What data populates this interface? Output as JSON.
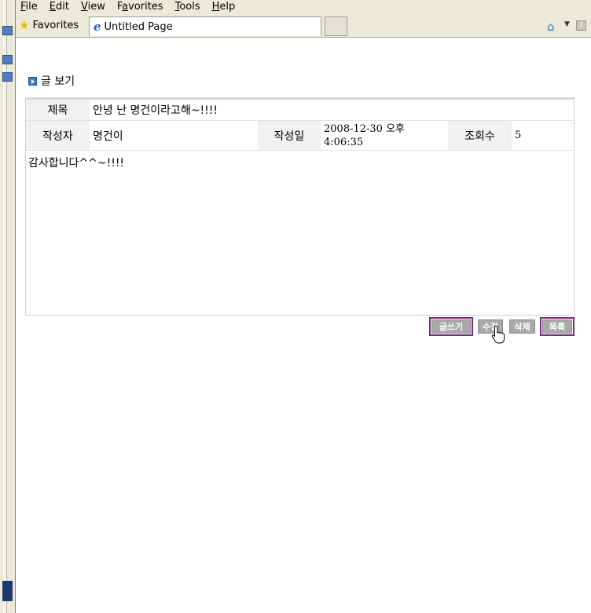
{
  "menu": {
    "items": [
      {
        "key": "F",
        "rest": "ile"
      },
      {
        "key": "E",
        "rest": "dit"
      },
      {
        "key": "V",
        "rest": "iew"
      },
      {
        "key": "a",
        "pre": "F",
        "rest": "vorites"
      },
      {
        "key": "T",
        "rest": "ools"
      },
      {
        "key": "H",
        "rest": "elp"
      }
    ]
  },
  "toolbar": {
    "favorites_label": "Favorites",
    "tab_title": "Untitled Page",
    "icons": [
      "star-icon",
      "ie-icon",
      "home-icon",
      "rss-icon"
    ]
  },
  "page": {
    "section_title": "글 보기",
    "post": {
      "title_label": "제목",
      "title_value": "안녕 난 명건이라고해~!!!!",
      "author_label": "작성자",
      "author_value": "명건이",
      "date_label": "작성일",
      "date_value_line1": "2008-12-30 오후",
      "date_value_line2": "4:06:35",
      "views_label": "조회수",
      "views_value": "5",
      "body": "감사합니다^^~!!!!"
    },
    "buttons": {
      "write": "글쓰기",
      "edit": "수정",
      "delete": "삭제",
      "list": "목록"
    }
  },
  "colors": {
    "button_bg": "#a9a9a9",
    "focus_outline": "#7a2c7d",
    "label_bg": "#f1f1f1",
    "chrome_bg": "#ece9d8"
  }
}
